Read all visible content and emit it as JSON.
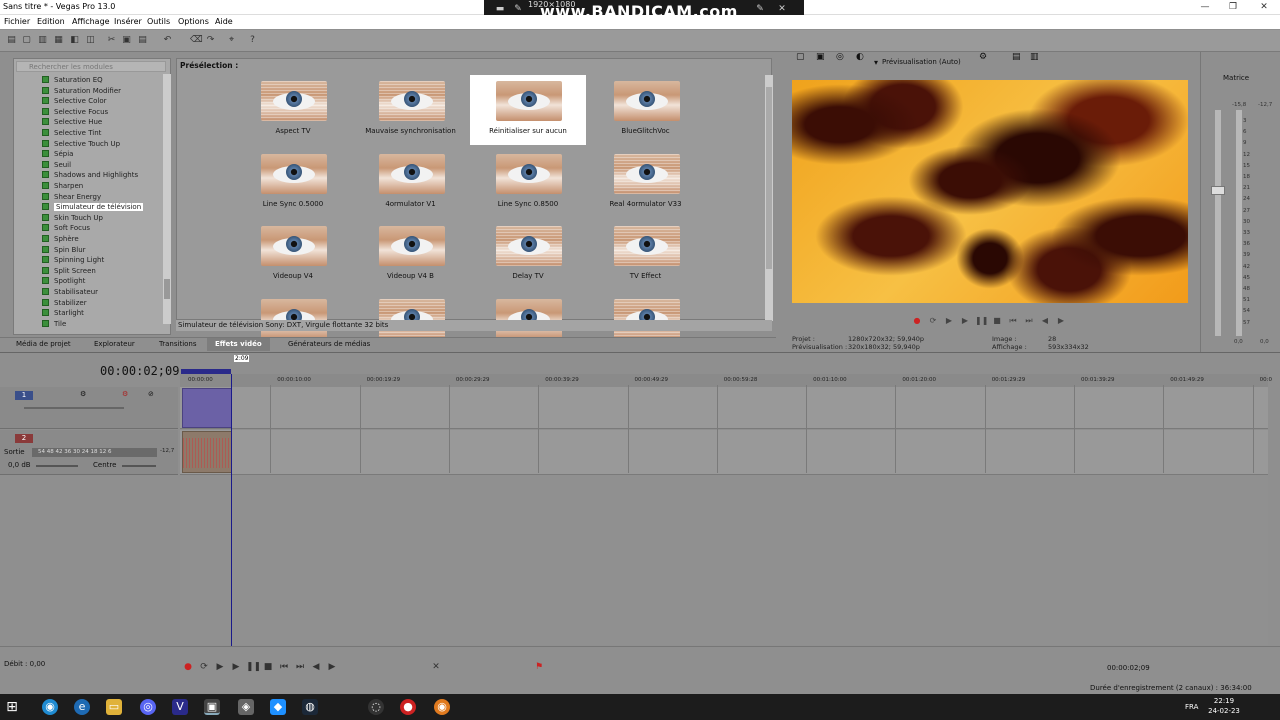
{
  "window": {
    "title": "Sans titre * - Vegas Pro 13.0"
  },
  "recorder": {
    "resolution": "1920×1080",
    "brand": "www.BANDICAM.com"
  },
  "menu": [
    "Fichier",
    "Edition",
    "Affichage",
    "Insérer",
    "Outils",
    "Options",
    "Aide"
  ],
  "tree": {
    "search_placeholder": "Rechercher les modules",
    "items": [
      "Saturation EQ",
      "Saturation Modifier",
      "Selective Color",
      "Selective Focus",
      "Selective Hue",
      "Selective Tint",
      "Selective Touch Up",
      "Sépia",
      "Seuil",
      "Shadows and Highlights",
      "Sharpen",
      "Shear Energy",
      "Simulateur de télévision",
      "Skin Touch Up",
      "Soft Focus",
      "Sphère",
      "Spin Blur",
      "Spinning Light",
      "Split Screen",
      "Spotlight",
      "Stabilisateur",
      "Stabilizer",
      "Starlight",
      "Tile"
    ],
    "selected": "Simulateur de télévision"
  },
  "presets": {
    "header": "Présélection :",
    "items": [
      {
        "label": "Aspect TV",
        "fx": "lines"
      },
      {
        "label": "Mauvaise synchronisation",
        "fx": "lines"
      },
      {
        "label": "Réinitialiser sur aucun",
        "fx": "none",
        "selected": true
      },
      {
        "label": "BlueGlitchVoc",
        "fx": "none"
      },
      {
        "label": "Line Sync 0.5000",
        "fx": "none"
      },
      {
        "label": "4ormulator V1",
        "fx": "none"
      },
      {
        "label": "Line Sync 0.8500",
        "fx": "none"
      },
      {
        "label": "Real 4ormulator V33",
        "fx": "lines"
      },
      {
        "label": "Videoup V4",
        "fx": "none"
      },
      {
        "label": "Videoup V4 B",
        "fx": "none"
      },
      {
        "label": "Delay TV",
        "fx": "lines"
      },
      {
        "label": "TV Effect",
        "fx": "lines"
      },
      {
        "label": "",
        "fx": "none"
      },
      {
        "label": "",
        "fx": "lines"
      },
      {
        "label": "",
        "fx": "none"
      },
      {
        "label": "",
        "fx": "lines"
      }
    ],
    "status": "Simulateur de télévision Sony: DXT, Virgule flottante 32 bits"
  },
  "window_tabs": [
    "Média de projet",
    "Explorateur",
    "Transitions",
    "Effets vidéo",
    "Générateurs de médias"
  ],
  "active_tab": "Effets vidéo",
  "preview": {
    "mode": "Prévisualisation (Auto)",
    "projet_label": "Projet :",
    "projet": "1280x720x32; 59,940p",
    "previsu_label": "Prévisualisation :",
    "previsu": "320x180x32; 59,940p",
    "image_label": "Image :",
    "image": "28",
    "affichage_label": "Affichage :",
    "affichage": "593x334x32"
  },
  "mixer": {
    "title": "Matrice",
    "levels": [
      "-15,8",
      "-12,7",
      "3",
      "6",
      "9",
      "12",
      "15",
      "18",
      "21",
      "24",
      "27",
      "30",
      "33",
      "36",
      "39",
      "42",
      "45",
      "48",
      "51",
      "54",
      "57"
    ],
    "bottom": [
      "0,0",
      "0,0"
    ]
  },
  "timeline": {
    "time": "00:00:02;09",
    "ticks": [
      "00:00:00",
      "00:00:10:00",
      "00:00:19:29",
      "00:00:29:29",
      "00:00:39:29",
      "00:00:49:29",
      "00:00:59:28",
      "00:01:10:00",
      "00:01:20:00",
      "00:01:29:29",
      "00:01:39:29",
      "00:01:49:29",
      "00:0"
    ],
    "loop_label": "2:09"
  },
  "tracks": {
    "t1": "1",
    "t2": "2",
    "sortie": "Sortie",
    "db": "0,0 dB",
    "centre": "Centre",
    "meter": "54 48 42 36 30 24 18 12 6",
    "meter_peak": "-12,7"
  },
  "bottom": {
    "debit": "Débit : 0,00",
    "time": "00:00:02;09",
    "record": "Durée d'enregistrement (2 canaux) : 36:34:00"
  },
  "taskbar": {
    "lang": "FRA",
    "time": "22:19",
    "date": "24-02-23"
  }
}
